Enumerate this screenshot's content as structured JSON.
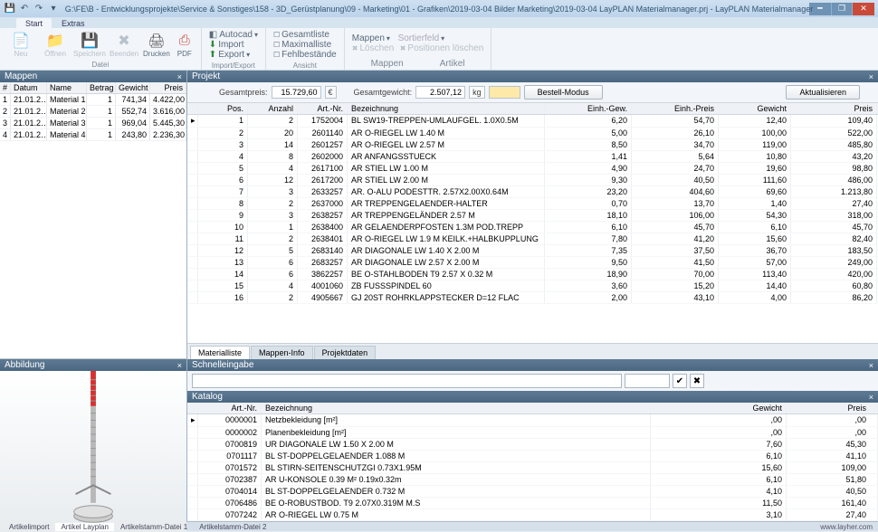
{
  "title": "G:\\FE\\B - Entwicklungsprojekte\\Service & Sonstiges\\158 - 3D_Gerüstplanung\\09 - Marketing\\01 - Grafiken\\2019-03-04 Bilder Marketing\\2019-03-04 LayPLAN Materialmanager.prj - LayPLAN Materialmanager",
  "tabs": {
    "start": "Start",
    "extras": "Extras"
  },
  "ribbon": {
    "datei_group": "Datei",
    "neu": "Neu",
    "offnen": "Öffnen",
    "speichern": "Speichern",
    "beenden": "Beenden",
    "drucken": "Drucken",
    "pdf": "PDF",
    "ie_group": "Import/Export",
    "ie_autocad": "Autocad",
    "ie_import": "Import",
    "ie_export": "Export",
    "ansicht_group": "Ansicht",
    "ans_gesamt": "Gesamtliste",
    "ans_max": "Maximalliste",
    "ans_fehl": "Fehlbestände",
    "mappen_group": "Mappen",
    "map_mappen": "Mappen",
    "map_sort": "Sortierfeld",
    "artikel_group": "Artikel",
    "art_loeschen": "Löschen",
    "art_pos": "Positionen löschen"
  },
  "panels": {
    "mappen": "Mappen",
    "abbildung": "Abbildung",
    "projekt": "Projekt",
    "schnell": "Schnelleingabe",
    "katalog": "Katalog"
  },
  "mappen_cols": {
    "idx": "#",
    "datum": "Datum",
    "name": "Name",
    "betrag": "Betrag",
    "gewicht": "Gewicht",
    "preis": "Preis"
  },
  "mappen_rows": [
    {
      "i": "1",
      "d": "21.01.2…",
      "n": "Material 1",
      "b": "1",
      "g": "741,34",
      "p": "4.422,00"
    },
    {
      "i": "2",
      "d": "21.01.2…",
      "n": "Material 2",
      "b": "1",
      "g": "552,74",
      "p": "3.616,00"
    },
    {
      "i": "3",
      "d": "21.01.2…",
      "n": "Material 3",
      "b": "1",
      "g": "969,04",
      "p": "5.445,30"
    },
    {
      "i": "4",
      "d": "21.01.2…",
      "n": "Material 4",
      "b": "1",
      "g": "243,80",
      "p": "2.236,30"
    }
  ],
  "projekt_ctrl": {
    "gesamtpreis_lbl": "Gesamtpreis:",
    "gesamtpreis_val": "15.729,60",
    "eur": "€",
    "gesamtgew_lbl": "Gesamtgewicht:",
    "gesamtgew_val": "2.507,12",
    "kg": "kg",
    "bestell": "Bestell-Modus",
    "aktual": "Aktualisieren"
  },
  "proj_cols": {
    "pos": "Pos.",
    "anz": "Anzahl",
    "art": "Art.-Nr.",
    "bez": "Bezeichnung",
    "einhgew": "Einh.-Gew.",
    "einhpreis": "Einh.-Preis",
    "gewicht": "Gewicht",
    "preis": "Preis"
  },
  "proj_rows": [
    {
      "p": "1",
      "a": "2",
      "ar": "1752004",
      "b": "BL SW19-TREPPEN-UMLAUFGEL. 1.0X0.5M",
      "eg": "6,20",
      "ep": "54,70",
      "g": "12,40",
      "pr": "109,40"
    },
    {
      "p": "2",
      "a": "20",
      "ar": "2601140",
      "b": "AR O-RIEGEL LW 1.40 M",
      "eg": "5,00",
      "ep": "26,10",
      "g": "100,00",
      "pr": "522,00"
    },
    {
      "p": "3",
      "a": "14",
      "ar": "2601257",
      "b": "AR O-RIEGEL LW 2.57 M",
      "eg": "8,50",
      "ep": "34,70",
      "g": "119,00",
      "pr": "485,80"
    },
    {
      "p": "4",
      "a": "8",
      "ar": "2602000",
      "b": "AR ANFANGSSTUECK",
      "eg": "1,41",
      "ep": "5,64",
      "g": "10,80",
      "pr": "43,20"
    },
    {
      "p": "5",
      "a": "4",
      "ar": "2617100",
      "b": "AR STIEL LW 1.00 M",
      "eg": "4,90",
      "ep": "24,70",
      "g": "19,60",
      "pr": "98,80"
    },
    {
      "p": "6",
      "a": "12",
      "ar": "2617200",
      "b": "AR STIEL LW 2.00 M",
      "eg": "9,30",
      "ep": "40,50",
      "g": "111,60",
      "pr": "486,00"
    },
    {
      "p": "7",
      "a": "3",
      "ar": "2633257",
      "b": "AR. O-ALU PODESTTR. 2.57X2.00X0.64M",
      "eg": "23,20",
      "ep": "404,60",
      "g": "69,60",
      "pr": "1.213,80"
    },
    {
      "p": "8",
      "a": "2",
      "ar": "2637000",
      "b": "AR TREPPENGELAENDER-HALTER",
      "eg": "0,70",
      "ep": "13,70",
      "g": "1,40",
      "pr": "27,40"
    },
    {
      "p": "9",
      "a": "3",
      "ar": "2638257",
      "b": "AR TREPPENGELÄNDER 2.57 M",
      "eg": "18,10",
      "ep": "106,00",
      "g": "54,30",
      "pr": "318,00"
    },
    {
      "p": "10",
      "a": "1",
      "ar": "2638400",
      "b": "AR GELAENDERPFOSTEN 1.3M POD.TREPP",
      "eg": "6,10",
      "ep": "45,70",
      "g": "6,10",
      "pr": "45,70"
    },
    {
      "p": "11",
      "a": "2",
      "ar": "2638401",
      "b": "AR O-RIEGEL LW 1.9 M KEILK.+HALBKUPPLUNG",
      "eg": "7,80",
      "ep": "41,20",
      "g": "15,60",
      "pr": "82,40"
    },
    {
      "p": "12",
      "a": "5",
      "ar": "2683140",
      "b": "AR DIAGONALE LW 1.40 X 2.00 M",
      "eg": "7,35",
      "ep": "37,50",
      "g": "36,70",
      "pr": "183,50"
    },
    {
      "p": "13",
      "a": "6",
      "ar": "2683257",
      "b": "AR DIAGONALE LW 2.57 X 2.00 M",
      "eg": "9,50",
      "ep": "41,50",
      "g": "57,00",
      "pr": "249,00"
    },
    {
      "p": "14",
      "a": "6",
      "ar": "3862257",
      "b": "BE O-STAHLBODEN T9 2.57 X 0.32 M",
      "eg": "18,90",
      "ep": "70,00",
      "g": "113,40",
      "pr": "420,00"
    },
    {
      "p": "15",
      "a": "4",
      "ar": "4001060",
      "b": "ZB FUSSSPINDEL 60",
      "eg": "3,60",
      "ep": "15,20",
      "g": "14,40",
      "pr": "60,80"
    },
    {
      "p": "16",
      "a": "2",
      "ar": "4905667",
      "b": "GJ 20ST ROHRKLAPPSTECKER D=12 FLAC",
      "eg": "2,00",
      "ep": "43,10",
      "g": "4,00",
      "pr": "86,20"
    }
  ],
  "subtabs": {
    "material": "Materialliste",
    "mappen": "Mappen-Info",
    "projekt": "Projektdaten"
  },
  "kat_cols": {
    "art": "Art.-Nr.",
    "bez": "Bezeichnung",
    "gew": "Gewicht",
    "preis": "Preis"
  },
  "kat_rows": [
    {
      "a": "0000001",
      "b": "Netzbekleidung [m²]",
      "g": ",00",
      "p": ",00"
    },
    {
      "a": "0000002",
      "b": "Planenbekleidung [m²]",
      "g": ",00",
      "p": ",00"
    },
    {
      "a": "0700819",
      "b": "UR DIAGONALE LW 1.50 X 2.00 M",
      "g": "7,60",
      "p": "45,30"
    },
    {
      "a": "0701117",
      "b": "BL ST-DOPPELGELAENDER 1.088 M",
      "g": "6,10",
      "p": "41,10"
    },
    {
      "a": "0701572",
      "b": "BL STIRN-SEITENSCHUTZGI 0.73X1.95M",
      "g": "15,60",
      "p": "109,00"
    },
    {
      "a": "0702387",
      "b": "AR U-KONSOLE 0.39 M² 0.19x0.32m",
      "g": "6,10",
      "p": "51,80"
    },
    {
      "a": "0704014",
      "b": "BL ST-DOPPELGELAENDER 0.732 M",
      "g": "4,10",
      "p": "40,50"
    },
    {
      "a": "0706486",
      "b": "BE O-ROBUSTBOD. T9 2.07X0.319M M.S",
      "g": "11,50",
      "p": "161,40"
    },
    {
      "a": "0707242",
      "b": "AR O-RIEGEL LW 0.75 M",
      "g": "3,10",
      "p": "27,40"
    }
  ],
  "bottom_tabs": {
    "t1": "Artikelimport",
    "t2": "Artikel Layplan",
    "t3": "Artikelstamm-Datei 1",
    "t4": "Artikelstamm-Datei 2"
  },
  "footer_url": "www.layher.com"
}
